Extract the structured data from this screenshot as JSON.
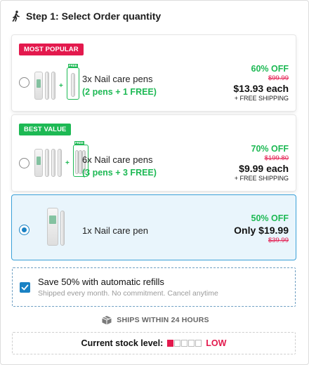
{
  "step": {
    "title": "Step 1: Select Order quantity",
    "icon": "walking-person-icon"
  },
  "options": [
    {
      "badge": "MOST POPULAR",
      "badge_color": "#e3194d",
      "selected": false,
      "title": "3x Nail care pens",
      "subtitle": "(2 pens + 1 FREE)",
      "discount": "60% OFF",
      "old_price": "$99.99",
      "price": "$13.93 each",
      "shipping": "+ FREE SHIPPING",
      "image": {
        "pens": 2,
        "free_pens": 1,
        "free_tag": "FREE"
      }
    },
    {
      "badge": "BEST VALUE",
      "badge_color": "#1db954",
      "selected": false,
      "title": "6x Nail care pens",
      "subtitle": "(3 pens + 3 FREE)",
      "discount": "70% OFF",
      "old_price": "$199.80",
      "price": "$9.99 each",
      "shipping": "+ FREE SHIPPING",
      "image": {
        "pens": 3,
        "free_pens": 3,
        "free_tag": "FREE"
      }
    },
    {
      "badge": "",
      "selected": true,
      "title": "1x Nail care pen",
      "subtitle": "",
      "discount": "50% OFF",
      "price": "Only $19.99",
      "old_price": "$39.99",
      "image": {
        "pens": 1,
        "free_pens": 0
      }
    }
  ],
  "refill": {
    "checked": true,
    "title": "Save 50% with automatic refills",
    "subtitle": "Shipped every month. No commitment. Cancel anytime"
  },
  "shipping_notice": {
    "text": "SHIPS WITHIN 24 HOURS",
    "icon": "package-box-icon"
  },
  "stock": {
    "label": "Current stock level:",
    "level": "LOW",
    "filled_cells": 1,
    "total_cells": 5
  },
  "colors": {
    "accent_blue": "#1a82c4",
    "green": "#1db954",
    "red": "#e3194d",
    "selected_bg": "#e9f5fc"
  }
}
